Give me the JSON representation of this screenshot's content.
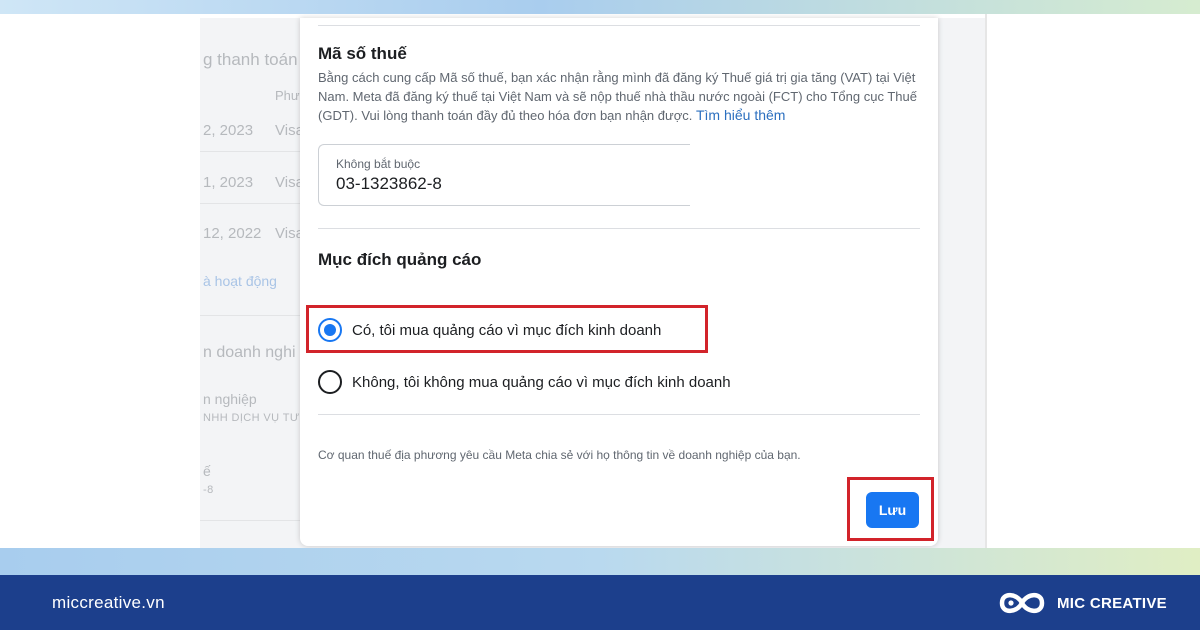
{
  "background": {
    "texts": [
      "g thanh toán",
      "Phư",
      "2, 2023",
      "Visa",
      "1, 2023",
      "Visa",
      "12, 2022",
      "Visa",
      "à hoạt động",
      "n doanh nghi",
      "n nghiệp",
      "NHH DỊCH VỤ TƯ",
      "ế",
      "-8"
    ]
  },
  "modal": {
    "tax_title": "Mã số thuế",
    "tax_description": "Bằng cách cung cấp Mã số thuế, bạn xác nhận rằng mình đã đăng ký Thuế giá trị gia tăng (VAT) tại Việt Nam. Meta đã đăng ký thuế tại Việt Nam và sẽ nộp thuế nhà thầu nước ngoài (FCT) cho Tổng cục Thuế (GDT). Vui lòng thanh toán đầy đủ theo hóa đơn bạn nhận được.",
    "learn_more": "Tìm hiểu thêm",
    "tax_input": {
      "placeholder": "Không bắt buộc",
      "value": "03-1323862-8"
    },
    "purpose_title": "Mục đích quảng cáo",
    "options": [
      {
        "label": "Có, tôi mua quảng cáo vì mục đích kinh doanh",
        "selected": true
      },
      {
        "label": "Không, tôi không mua quảng cáo vì mục đích kinh doanh",
        "selected": false
      }
    ],
    "footer_note": "Cơ quan thuế địa phương yêu cầu Meta chia sẻ với họ thông tin về doanh nghiệp của bạn.",
    "save_label": "Lưu"
  },
  "footer": {
    "site": "miccreative.vn",
    "brand": "MIC CREATIVE"
  },
  "colors": {
    "accent": "#1877f2",
    "highlight": "#d2232a",
    "footer_bar": "#1c3f8c"
  },
  "icons": {
    "brand_logo": "infinity-logo-icon"
  }
}
